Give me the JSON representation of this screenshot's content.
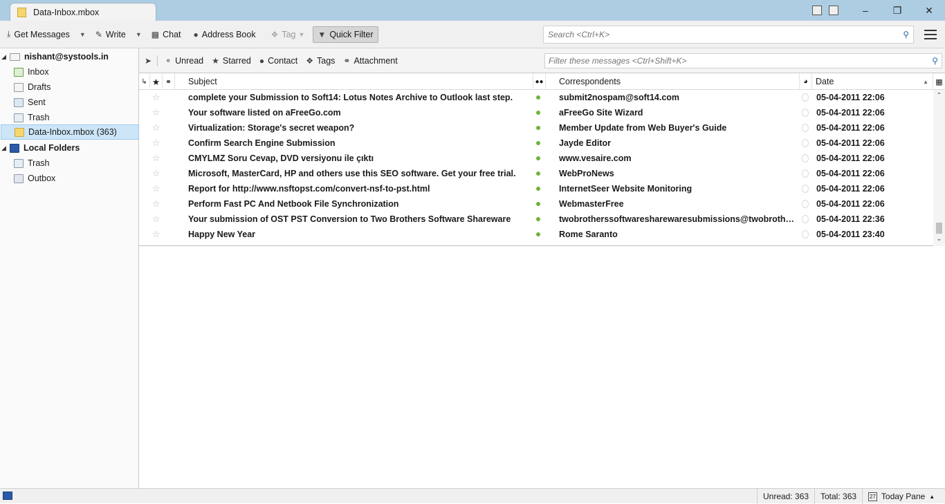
{
  "tab": {
    "title": "Data-Inbox.mbox"
  },
  "toolbar": {
    "get_messages": "Get Messages",
    "write": "Write",
    "chat": "Chat",
    "address_book": "Address Book",
    "tag": "Tag",
    "quick_filter": "Quick Filter",
    "search_placeholder": "Search <Ctrl+K>"
  },
  "sidebar": {
    "account": "nishant@systools.in",
    "inbox": "Inbox",
    "drafts": "Drafts",
    "sent": "Sent",
    "trash": "Trash",
    "mbox": "Data-Inbox.mbox (363)",
    "local_folders": "Local Folders",
    "local_trash": "Trash",
    "outbox": "Outbox"
  },
  "quickfilter": {
    "unread": "Unread",
    "starred": "Starred",
    "contact": "Contact",
    "tags": "Tags",
    "attachment": "Attachment",
    "filter_placeholder": "Filter these messages <Ctrl+Shift+K>"
  },
  "columns": {
    "subject": "Subject",
    "correspondents": "Correspondents",
    "date": "Date"
  },
  "messages": [
    {
      "subject": "complete your Submission to Soft14: Lotus Notes Archive to Outlook last step.",
      "correspondent": "submit2nospam@soft14.com",
      "date": "05-04-2011 22:06"
    },
    {
      "subject": "Your software listed on aFreeGo.com",
      "correspondent": "aFreeGo Site Wizard",
      "date": "05-04-2011 22:06"
    },
    {
      "subject": "Virtualization: Storage's secret weapon?",
      "correspondent": "Member Update from Web Buyer's Guide",
      "date": "05-04-2011 22:06"
    },
    {
      "subject": "Confirm Search Engine Submission",
      "correspondent": "Jayde Editor",
      "date": "05-04-2011 22:06"
    },
    {
      "subject": "CMYLMZ Soru Cevap, DVD versiyonu ile çıktı",
      "correspondent": "www.vesaire.com",
      "date": "05-04-2011 22:06"
    },
    {
      "subject": "Microsoft, MasterCard, HP and others use this SEO software. Get your free trial.",
      "correspondent": "WebProNews",
      "date": "05-04-2011 22:06"
    },
    {
      "subject": "Report for http://www.nsftopst.com/convert-nsf-to-pst.html",
      "correspondent": "InternetSeer Website Monitoring",
      "date": "05-04-2011 22:06"
    },
    {
      "subject": "Perform Fast PC And Netbook File Synchronization",
      "correspondent": "WebmasterFree",
      "date": "05-04-2011 22:06"
    },
    {
      "subject": "Your submission of OST PST Conversion to Two Brothers Software Shareware",
      "correspondent": "twobrotherssoftwaresharewaresubmissions@twobrotherss...",
      "date": "05-04-2011 22:36"
    },
    {
      "subject": "Happy New Year",
      "correspondent": "Rome Saranto",
      "date": "05-04-2011 23:40"
    }
  ],
  "status": {
    "unread": "Unread: 363",
    "total": "Total: 363",
    "today_pane": "Today Pane",
    "calendar_day": "27"
  },
  "colors": {
    "titlebar": "#adcde3",
    "selected_folder": "#cce6f8",
    "unread_dot": "#6fb33a",
    "search_icon": "#2b6ea8"
  }
}
